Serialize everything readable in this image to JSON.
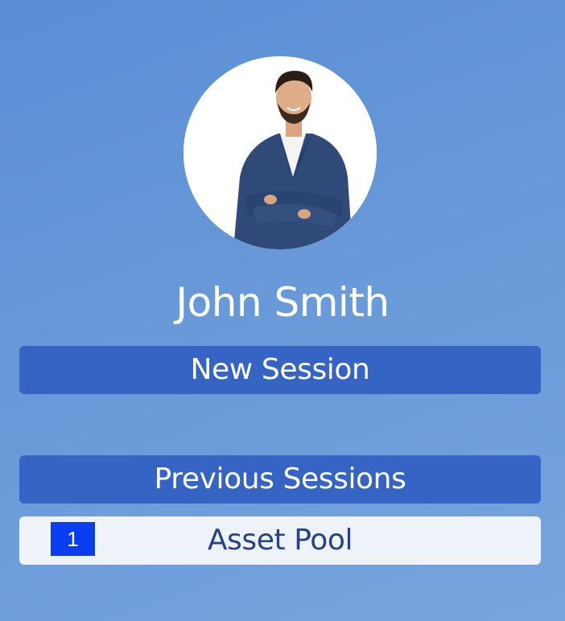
{
  "profile": {
    "avatar_icon": "person-avatar-photo",
    "name": "John Smith"
  },
  "actions": {
    "new_session_label": "New Session"
  },
  "sessions": {
    "header": "Previous Sessions",
    "items": [
      {
        "number": "1",
        "title": "Asset Pool"
      }
    ]
  },
  "colors": {
    "background": "#5b8dd6",
    "button_blue": "#3564c4",
    "row_background": "#eef3fa",
    "row_text": "#26408a",
    "badge_blue": "#0a3cf0"
  }
}
